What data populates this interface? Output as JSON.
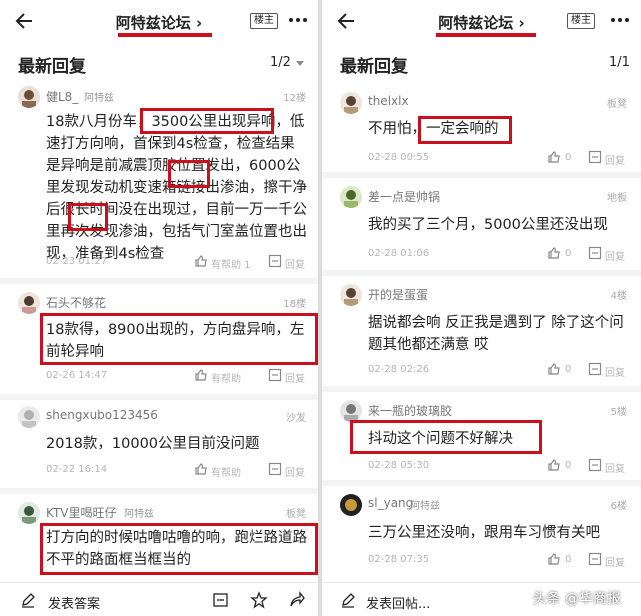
{
  "left": {
    "forum_title": "阿特兹论坛",
    "host_badge": "楼主",
    "section_title": "最新回复",
    "page_indicator": "1/2",
    "posts": [
      {
        "user": "健L8_",
        "tag": "阿特兹",
        "floor": "12楼",
        "text": "18款八月份车，3500公里出现异响，低速打方向响，首保到4s检查，检查结果是异响是前减震顶胶位置发出，6000公里发现发动机变速箱链接出渗油，擦干净后很长时间没在出现过，目前一万一千公里再次发现渗油，包括气门室盖位置也出现，准备到4s检查",
        "time": "02-23 01:27",
        "like": "有帮助 1",
        "reply": "回复"
      },
      {
        "user": "石头不够花",
        "floor": "18楼",
        "text": "18款得，8900出现的，方向盘异响，左前轮异响",
        "time": "02-26 14:47",
        "like": "有帮助",
        "reply": "回复"
      },
      {
        "user": "shengxubo123456",
        "floor": "沙发",
        "text": "2018款，10000公里目前没问题",
        "time": "02-22 16:14",
        "like": "有帮助",
        "reply": "回复"
      },
      {
        "user": "KTV里喝旺仔",
        "tag": "阿特兹",
        "floor": "板凳",
        "text": "打方向的时候咕噜咕噜的响，跑烂路道路不平的路面框当框当的"
      }
    ],
    "highlight": {
      "a": "3500公里出现异响",
      "b": "渗油",
      "c": "渗油"
    },
    "bottom": {
      "compose": "发表答案"
    }
  },
  "right": {
    "forum_title": "阿特兹论坛",
    "host_badge": "楼主",
    "section_title": "最新回复",
    "page_indicator": "1/1",
    "posts": [
      {
        "user": "thelxlx",
        "floor": "板凳",
        "text": "不用怕，一定会响的",
        "time": "02-28 00:55",
        "like": "0",
        "reply": "回复"
      },
      {
        "user": "差一点是帅锅",
        "floor": "地板",
        "text": "我的买了三个月，5000公里还没出现",
        "time": "02-28 01:06",
        "like": "0",
        "reply": "回复"
      },
      {
        "user": "开的是蛋蛋",
        "floor": "4楼",
        "text": "据说都会响 反正我是遇到了 除了这个问题其他都还满意 哎",
        "time": "02-28 02:26",
        "like": "0",
        "reply": "回复"
      },
      {
        "user": "来一瓶的玻璃胶",
        "floor": "5楼",
        "text": "抖动这个问题不好解决",
        "time": "02-28 05:30",
        "like": "0",
        "reply": "回复"
      },
      {
        "user": "sl_yang",
        "tag": "阿特兹",
        "floor": "6楼",
        "text": "三万公里还没响，跟用车习惯有关吧",
        "time": "02-28 07:35",
        "like": "0",
        "reply": "回复"
      }
    ],
    "bottom": {
      "compose": "发表回帖..."
    }
  },
  "watermark": "头条 @华商报",
  "colors": {
    "highlight_red": "#c8101f",
    "meta_gray": "#b5b5b5"
  }
}
